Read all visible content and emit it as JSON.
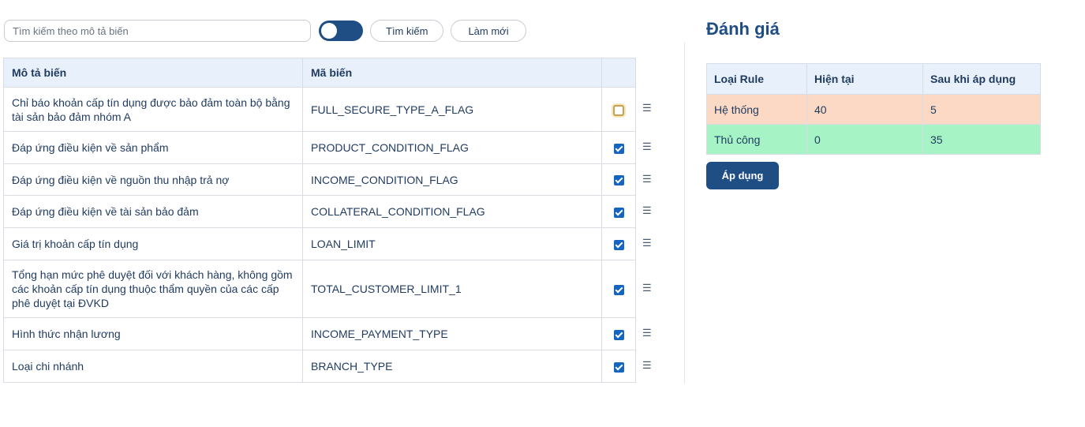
{
  "search": {
    "placeholder": "Tìm kiếm theo mô tả biến"
  },
  "toolbar": {
    "search_label": "Tìm kiếm",
    "refresh_label": "Làm mới"
  },
  "variables_table": {
    "headers": {
      "description": "Mô tả biến",
      "code": "Mã biến"
    },
    "rows": [
      {
        "description": "Chỉ báo khoản cấp tín dụng được bảo đảm toàn bộ bằng tài sản bảo đảm nhóm A",
        "code": "FULL_SECURE_TYPE_A_FLAG",
        "checked": false
      },
      {
        "description": "Đáp ứng điều kiện về sản phẩm",
        "code": "PRODUCT_CONDITION_FLAG",
        "checked": true
      },
      {
        "description": "Đáp ứng điều kiện về nguồn thu nhập trả nợ",
        "code": "INCOME_CONDITION_FLAG",
        "checked": true
      },
      {
        "description": "Đáp ứng điều kiện về tài sản bảo đảm",
        "code": "COLLATERAL_CONDITION_FLAG",
        "checked": true
      },
      {
        "description": "Giá trị khoản cấp tín dụng",
        "code": "LOAN_LIMIT",
        "checked": true
      },
      {
        "description": "Tổng hạn mức phê duyệt đối với khách hàng, không gồm các khoản cấp tín dụng thuộc thẩm quyền của các cấp phê duyệt tại ĐVKD",
        "code": "TOTAL_CUSTOMER_LIMIT_1",
        "checked": true
      },
      {
        "description": "Hình thức nhận lương",
        "code": "INCOME_PAYMENT_TYPE",
        "checked": true
      },
      {
        "description": "Loại chi nhánh",
        "code": "BRANCH_TYPE",
        "checked": true
      }
    ]
  },
  "evaluation": {
    "title": "Đánh giá",
    "headers": {
      "rule_type": "Loại Rule",
      "current": "Hiện tại",
      "after": "Sau khi áp dụng"
    },
    "rows": [
      {
        "rule_type": "Hệ thống",
        "current": "40",
        "after": "5",
        "color": "#fcd9c4"
      },
      {
        "rule_type": "Thủ công",
        "current": "0",
        "after": "35",
        "color": "#a6f4c5"
      }
    ],
    "apply_label": "Áp dụng"
  },
  "colors": {
    "primary": "#1f4e85",
    "header_bg": "#e8f1fb",
    "checkbox": "#1565c0"
  }
}
